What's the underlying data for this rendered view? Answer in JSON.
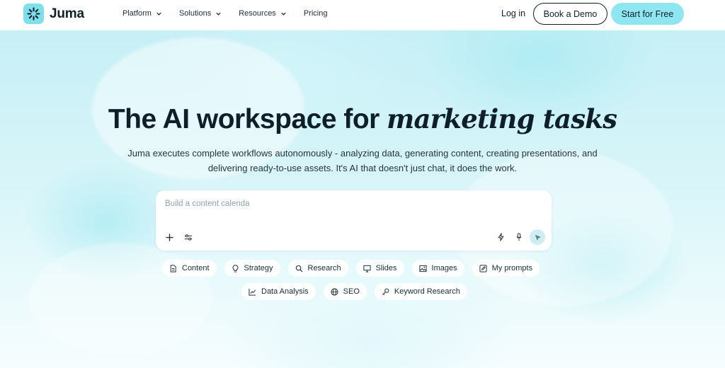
{
  "brand": {
    "name": "Juma",
    "logo_color": "#7fe0ec",
    "icon": "burst-icon"
  },
  "nav": {
    "items": [
      {
        "label": "Platform",
        "has_dropdown": true
      },
      {
        "label": "Solutions",
        "has_dropdown": true
      },
      {
        "label": "Resources",
        "has_dropdown": true
      },
      {
        "label": "Pricing",
        "has_dropdown": false
      }
    ],
    "login": "Log in",
    "demo": "Book a Demo",
    "start": "Start for Free"
  },
  "hero": {
    "title_plain": "The AI workspace for ",
    "title_italic": "marketing tasks",
    "subtitle_line1": "Juma executes complete workflows autonomously - analyzing data, generating content, creating presentations, and",
    "subtitle_line2": "delivering ready-to-use assets. It's AI that doesn't just chat, it does the work."
  },
  "prompt": {
    "placeholder": "Build a content calenda",
    "value": "",
    "left_tools": [
      "plus-icon",
      "sliders-icon"
    ],
    "right_tools": [
      "lightning-icon",
      "microphone-icon",
      "send-icon"
    ]
  },
  "chips_row1": [
    {
      "label": "Content",
      "icon": "document-icon"
    },
    {
      "label": "Strategy",
      "icon": "lightbulb-icon"
    },
    {
      "label": "Research",
      "icon": "search-icon"
    },
    {
      "label": "Slides",
      "icon": "presentation-icon"
    },
    {
      "label": "Images",
      "icon": "image-icon"
    },
    {
      "label": "My prompts",
      "icon": "edit-icon"
    }
  ],
  "chips_row2": [
    {
      "label": "Data Analysis",
      "icon": "chart-icon"
    },
    {
      "label": "SEO",
      "icon": "globe-icon"
    },
    {
      "label": "Keyword Research",
      "icon": "key-icon"
    }
  ],
  "colors": {
    "accent": "#8ee6f1",
    "text": "#0f1f2a",
    "background": "#c6f0f6"
  }
}
